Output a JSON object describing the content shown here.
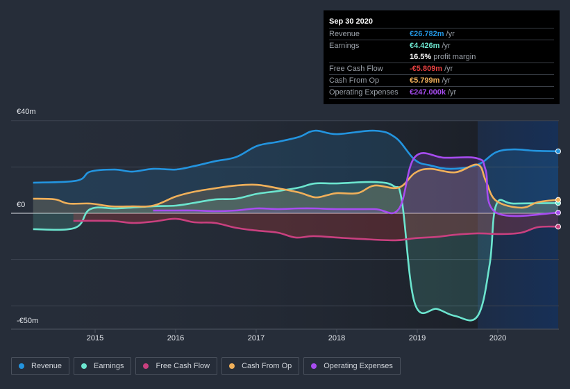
{
  "tooltip": {
    "date": "Sep 30 2020",
    "rows": [
      {
        "label": "Revenue",
        "value": "€26.782m",
        "unit": "/yr",
        "color": "#2394df"
      },
      {
        "label": "Earnings",
        "value": "€4.426m",
        "unit": "/yr",
        "color": "#6ce5cf"
      },
      {
        "label": "",
        "value": "16.5%",
        "unit": "profit margin",
        "color": "#ffffff"
      },
      {
        "label": "Free Cash Flow",
        "value": "-€5.809m",
        "unit": "/yr",
        "color": "#e64141"
      },
      {
        "label": "Cash From Op",
        "value": "€5.799m",
        "unit": "/yr",
        "color": "#f0b05a"
      },
      {
        "label": "Operating Expenses",
        "value": "€247.000k",
        "unit": "/yr",
        "color": "#a74cf0"
      }
    ]
  },
  "legend": [
    {
      "label": "Revenue",
      "color": "#2394df"
    },
    {
      "label": "Earnings",
      "color": "#6ce5cf"
    },
    {
      "label": "Free Cash Flow",
      "color": "#c9407f"
    },
    {
      "label": "Cash From Op",
      "color": "#f0b05a"
    },
    {
      "label": "Operating Expenses",
      "color": "#a74cf0"
    }
  ],
  "chart_data": {
    "type": "area",
    "title": "",
    "xlabel": "",
    "ylabel": "",
    "ylim": [
      -50,
      40
    ],
    "xlim": [
      2014.23,
      2020.75
    ],
    "y_tick_labels": [
      {
        "value": 40,
        "label": "€40m"
      },
      {
        "value": 0,
        "label": "€0"
      },
      {
        "value": -50,
        "label": "-€50m"
      }
    ],
    "y_gridlines": [
      40,
      20,
      0,
      -20,
      -40,
      -50
    ],
    "x_ticks": [
      2015,
      2016,
      2017,
      2018,
      2019,
      2020
    ],
    "highlight_range": [
      2019.75,
      2020.75
    ],
    "grid": true,
    "legend_position": "bottom",
    "series": [
      {
        "name": "Revenue",
        "color": "#2394df",
        "x": [
          2014.23,
          2014.77,
          2014.94,
          2015.24,
          2015.46,
          2015.72,
          2016.0,
          2016.23,
          2016.49,
          2016.75,
          2017.01,
          2017.27,
          2017.53,
          2017.73,
          2018.0,
          2018.47,
          2018.73,
          2018.97,
          2019.16,
          2019.42,
          2019.75,
          2019.98,
          2020.2,
          2020.46,
          2020.75
        ],
        "values": [
          13.2,
          14.1,
          18.0,
          18.9,
          18.0,
          19.2,
          18.9,
          20.4,
          22.5,
          24.3,
          29.1,
          30.9,
          33.0,
          35.7,
          34.2,
          35.7,
          32.7,
          23.1,
          20.7,
          19.2,
          21.0,
          26.4,
          27.6,
          27.0,
          26.8
        ]
      },
      {
        "name": "Earnings",
        "color": "#6ce5cf",
        "x": [
          2014.23,
          2014.75,
          2014.94,
          2015.28,
          2015.72,
          2016.0,
          2016.23,
          2016.49,
          2016.75,
          2017.01,
          2017.27,
          2017.53,
          2017.73,
          2018.0,
          2018.47,
          2018.71,
          2018.81,
          2018.97,
          2019.25,
          2019.47,
          2019.75,
          2019.9,
          2019.98,
          2020.2,
          2020.75
        ],
        "values": [
          -6.9,
          -6.3,
          1.8,
          2.1,
          3.0,
          3.3,
          4.5,
          6.0,
          6.3,
          8.4,
          9.6,
          11.1,
          12.9,
          12.9,
          13.5,
          11.7,
          5.1,
          -39.0,
          -41.4,
          -44.4,
          -44.4,
          -21.9,
          3.6,
          4.2,
          4.4
        ]
      },
      {
        "name": "Free Cash Flow",
        "color": "#c9407f",
        "fill": "#e64141",
        "x": [
          2014.73,
          2015.2,
          2015.46,
          2015.72,
          2016.0,
          2016.23,
          2016.49,
          2016.75,
          2017.01,
          2017.27,
          2017.49,
          2017.71,
          2018.0,
          2018.3,
          2018.73,
          2018.97,
          2019.25,
          2019.47,
          2019.75,
          2020.03,
          2020.29,
          2020.5,
          2020.75
        ],
        "values": [
          -3.3,
          -3.3,
          -4.2,
          -3.6,
          -2.4,
          -3.9,
          -4.2,
          -6.3,
          -7.5,
          -8.4,
          -10.5,
          -9.9,
          -10.5,
          -11.1,
          -11.7,
          -10.8,
          -10.2,
          -9.3,
          -8.7,
          -9.0,
          -8.4,
          -6.0,
          -5.8
        ]
      },
      {
        "name": "Cash From Op",
        "color": "#f0b05a",
        "x": [
          2014.23,
          2014.5,
          2014.67,
          2014.94,
          2015.2,
          2015.46,
          2015.72,
          2016.0,
          2016.23,
          2016.49,
          2016.75,
          2017.01,
          2017.27,
          2017.53,
          2017.73,
          2017.88,
          2018.0,
          2018.26,
          2018.47,
          2018.77,
          2018.97,
          2019.16,
          2019.47,
          2019.75,
          2019.85,
          2019.98,
          2020.29,
          2020.5,
          2020.75
        ],
        "values": [
          6.3,
          6.0,
          4.2,
          4.2,
          3.0,
          3.0,
          3.3,
          7.2,
          9.3,
          10.8,
          12.0,
          12.3,
          10.8,
          9.0,
          6.9,
          7.8,
          8.7,
          8.7,
          12.0,
          11.1,
          17.4,
          19.2,
          17.7,
          21.0,
          14.1,
          5.4,
          2.4,
          4.8,
          5.8
        ]
      },
      {
        "name": "Operating Expenses",
        "color": "#a74cf0",
        "x": [
          2015.72,
          2016.0,
          2016.23,
          2016.49,
          2016.75,
          2017.01,
          2017.27,
          2017.53,
          2017.73,
          2018.0,
          2018.47,
          2018.77,
          2018.97,
          2019.34,
          2019.75,
          2019.85,
          2019.98,
          2020.75
        ],
        "values": [
          1.2,
          1.2,
          1.2,
          0.9,
          1.2,
          2.1,
          1.8,
          2.1,
          2.1,
          1.8,
          1.8,
          1.8,
          24.3,
          24.0,
          23.7,
          18.6,
          0.25,
          0.25
        ]
      }
    ]
  }
}
